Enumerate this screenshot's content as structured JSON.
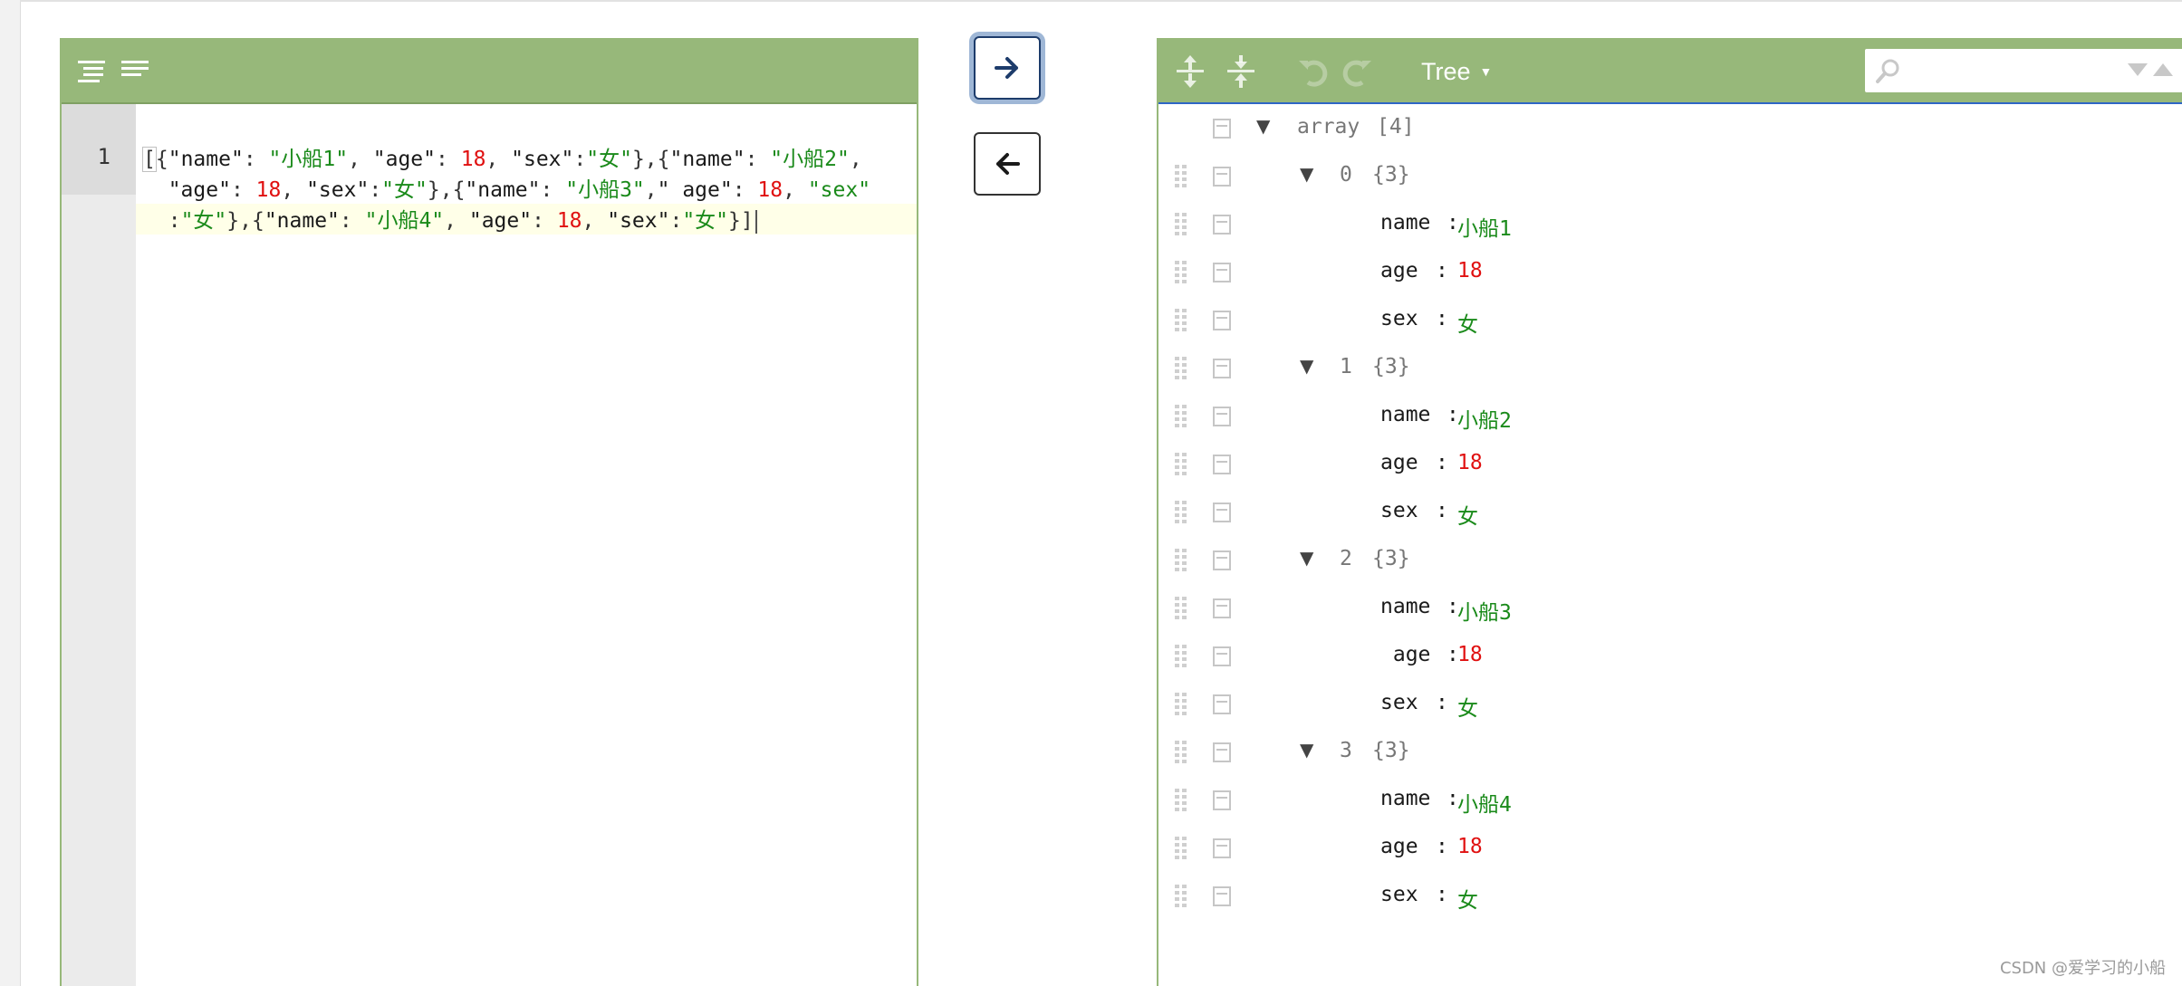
{
  "editor": {
    "line_number": "1",
    "lines": [
      [
        "[",
        "{",
        "\"name\"",
        ": ",
        "\"小船1\"",
        ", ",
        "\"age\"",
        ": ",
        "18",
        ", ",
        "\"sex\"",
        ":",
        "\"女\"",
        "},{",
        "\"name\"",
        ": ",
        "\"小船2\"",
        ","
      ],
      [
        "  ",
        "\"age\"",
        ": ",
        "18",
        ", ",
        "\"sex\"",
        ":",
        "\"女\"",
        "},{",
        "\"name\"",
        ": ",
        "\"小船3\"",
        ",",
        "\" age\"",
        ": ",
        "18",
        ", ",
        "\"sex\""
      ],
      [
        "  ",
        ":",
        "\"女\"",
        "},{",
        "\"name\"",
        ": ",
        "\"小船4\"",
        ", ",
        "\"age\"",
        ": ",
        "18",
        ", ",
        "\"sex\"",
        ":",
        "\"女\"",
        "}]"
      ]
    ]
  },
  "buttons": {
    "to_right_icon": "arrow-right-icon",
    "to_left_icon": "arrow-left-icon"
  },
  "tree_toolbar": {
    "mode_label": "Tree",
    "search_placeholder": ""
  },
  "tree": {
    "root": {
      "key": "array",
      "meta": "[4]"
    },
    "items": [
      {
        "index": "0",
        "meta": "{3}",
        "fields": [
          {
            "key": "name",
            "sep": ":",
            "value": "小船1",
            "type": "string"
          },
          {
            "key": "age",
            "sep": ":",
            "value": "18",
            "type": "number"
          },
          {
            "key": "sex",
            "sep": ":",
            "value": "女",
            "type": "string"
          }
        ]
      },
      {
        "index": "1",
        "meta": "{3}",
        "fields": [
          {
            "key": "name",
            "sep": ":",
            "value": "小船2",
            "type": "string"
          },
          {
            "key": "age",
            "sep": ":",
            "value": "18",
            "type": "number"
          },
          {
            "key": "sex",
            "sep": ":",
            "value": "女",
            "type": "string"
          }
        ]
      },
      {
        "index": "2",
        "meta": "{3}",
        "fields": [
          {
            "key": "name",
            "sep": ":",
            "value": "小船3",
            "type": "string"
          },
          {
            "key": " age",
            "sep": ":",
            "value": "18",
            "type": "number"
          },
          {
            "key": "sex",
            "sep": ":",
            "value": "女",
            "type": "string"
          }
        ]
      },
      {
        "index": "3",
        "meta": "{3}",
        "fields": [
          {
            "key": "name",
            "sep": ":",
            "value": "小船4",
            "type": "string"
          },
          {
            "key": "age",
            "sep": ":",
            "value": "18",
            "type": "number"
          },
          {
            "key": "sex",
            "sep": ":",
            "value": "女",
            "type": "string"
          }
        ]
      }
    ]
  },
  "watermark": "CSDN @爱学习的小船",
  "colors": {
    "menubar": "#97b87a",
    "string": "#1a8a1a",
    "number": "#e01010"
  }
}
